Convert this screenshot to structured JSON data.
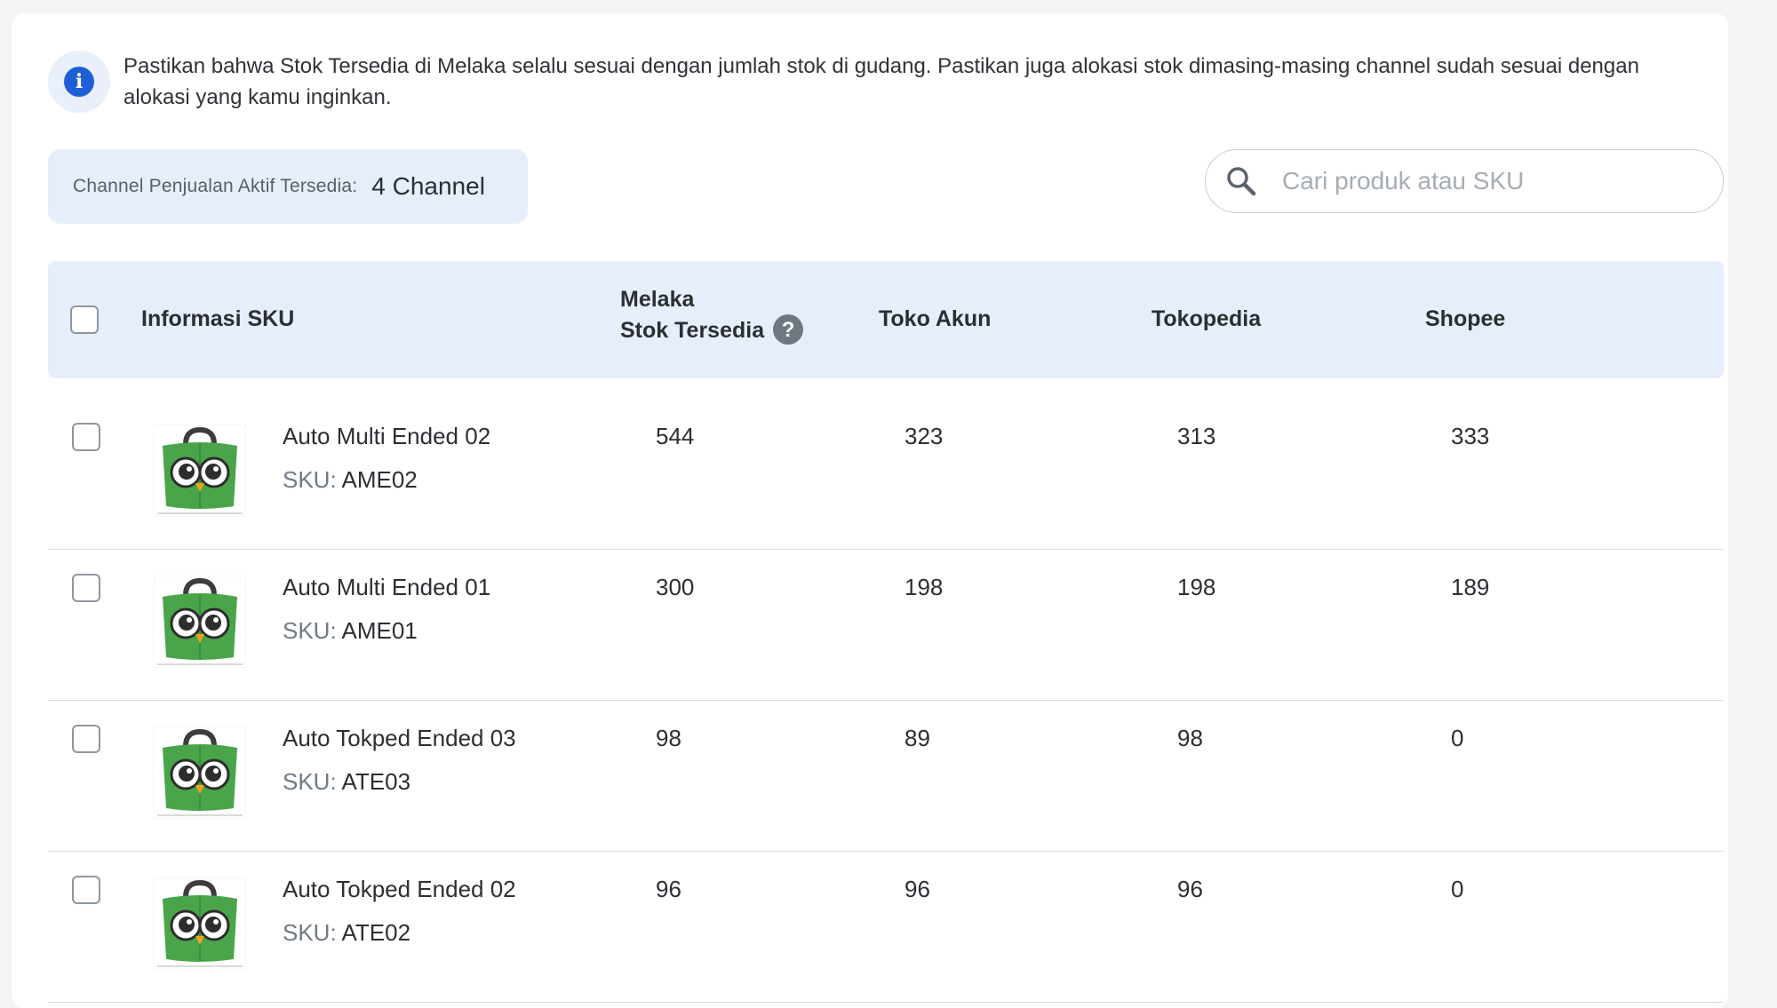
{
  "banner": {
    "text": "Pastikan bahwa Stok Tersedia di Melaka selalu sesuai dengan jumlah stok di gudang. Pastikan juga alokasi stok dimasing-masing channel sudah sesuai dengan alokasi yang kamu inginkan."
  },
  "channel_summary": {
    "label": "Channel Penjualan Aktif Tersedia:",
    "value": "4 Channel"
  },
  "search": {
    "placeholder": "Cari produk atau SKU",
    "value": ""
  },
  "table": {
    "headers": {
      "sku_info": "Informasi SKU",
      "melaka_line1": "Melaka",
      "melaka_line2": "Stok Tersedia",
      "toko_akun": "Toko Akun",
      "tokopedia": "Tokopedia",
      "shopee": "Shopee"
    },
    "rows": [
      {
        "name": "Auto Multi Ended 02",
        "sku_label": "SKU:",
        "sku": "AME02",
        "melaka": "544",
        "toko_akun": "323",
        "tokopedia": "313",
        "shopee": "333"
      },
      {
        "name": "Auto Multi Ended 01",
        "sku_label": "SKU:",
        "sku": "AME01",
        "melaka": "300",
        "toko_akun": "198",
        "tokopedia": "198",
        "shopee": "189"
      },
      {
        "name": "Auto Tokped Ended 03",
        "sku_label": "SKU:",
        "sku": "ATE03",
        "melaka": "98",
        "toko_akun": "89",
        "tokopedia": "98",
        "shopee": "0"
      },
      {
        "name": "Auto Tokped Ended 02",
        "sku_label": "SKU:",
        "sku": "ATE02",
        "melaka": "96",
        "toko_akun": "96",
        "tokopedia": "96",
        "shopee": "0"
      }
    ]
  },
  "colors": {
    "accent": "#1f5fd6",
    "header_bg": "#e6eefc",
    "product_green": "#4aa54a"
  },
  "icons": {
    "info": "info-icon",
    "search": "search-icon",
    "help": "help-icon",
    "thumb": "owl-bag-logo"
  }
}
